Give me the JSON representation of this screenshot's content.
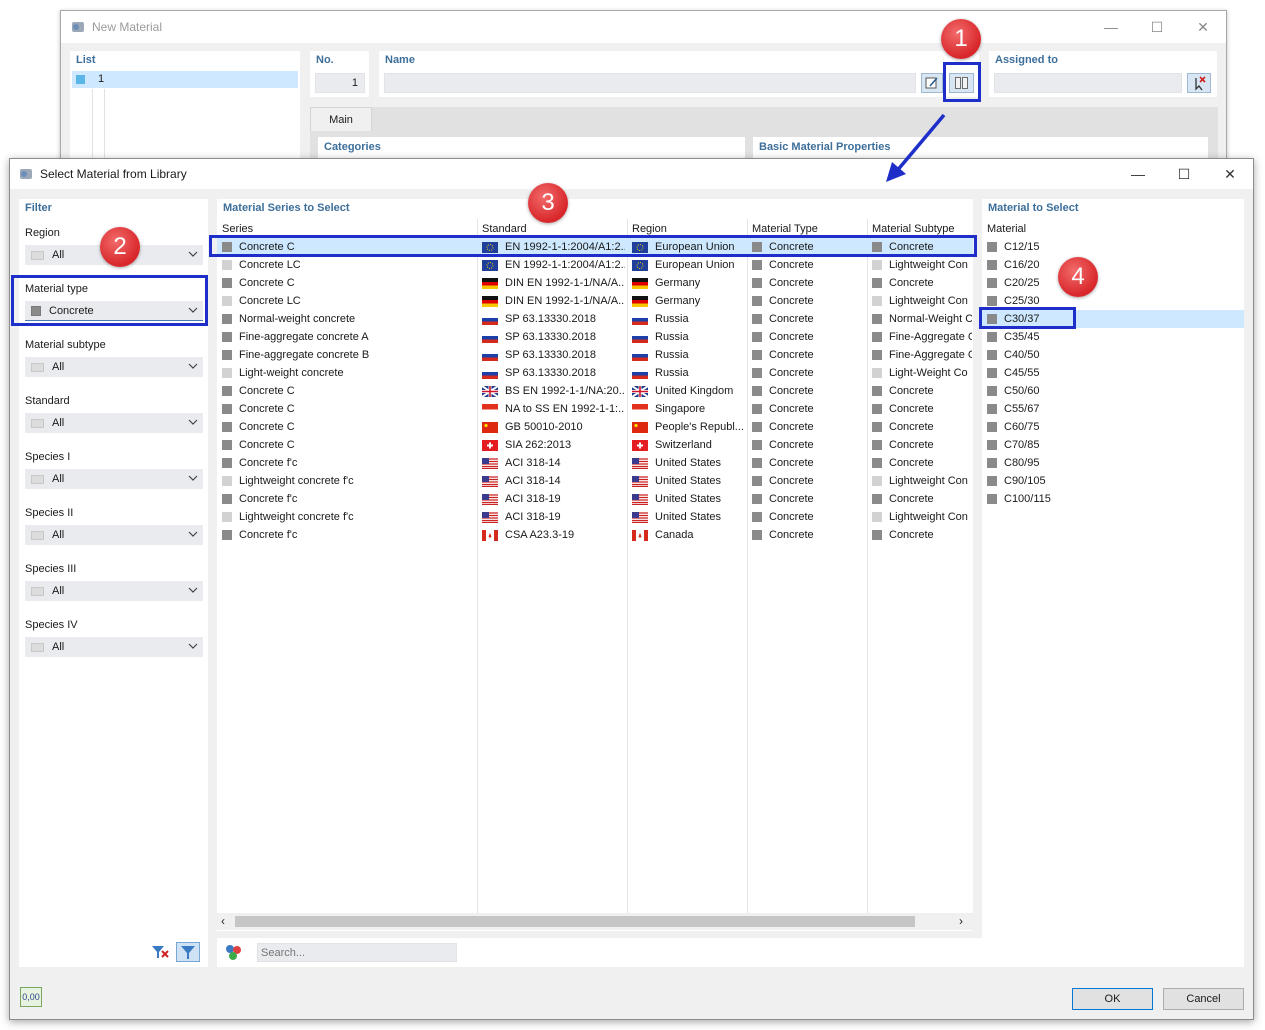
{
  "new_material": {
    "title": "New Material",
    "list_label": "List",
    "list_items": [
      "1"
    ],
    "no_label": "No.",
    "no_value": "1",
    "name_label": "Name",
    "name_value": "",
    "assigned_label": "Assigned to",
    "tab_main": "Main",
    "categories": "Categories",
    "basic_props": "Basic Material Properties"
  },
  "dialog": {
    "title": "Select Material from Library"
  },
  "filter": {
    "title": "Filter",
    "fields": [
      {
        "label": "Region",
        "value": "All"
      },
      {
        "label": "Material type",
        "value": "Concrete"
      },
      {
        "label": "Material subtype",
        "value": "All"
      },
      {
        "label": "Standard",
        "value": "All"
      },
      {
        "label": "Species I",
        "value": "All"
      },
      {
        "label": "Species II",
        "value": "All"
      },
      {
        "label": "Species III",
        "value": "All"
      },
      {
        "label": "Species IV",
        "value": "All"
      }
    ]
  },
  "series": {
    "title": "Material Series to Select",
    "columns": [
      "Series",
      "Standard",
      "Region",
      "Material Type",
      "Material Subtype"
    ],
    "rows": [
      {
        "series": "Concrete C",
        "standard": "EN 1992-1-1:2004/A1:2...",
        "region": "European Union",
        "type": "Concrete",
        "subtype": "Concrete",
        "flag": "eu",
        "light": false
      },
      {
        "series": "Concrete LC",
        "standard": "EN 1992-1-1:2004/A1:2...",
        "region": "European Union",
        "type": "Concrete",
        "subtype": "Lightweight Con",
        "flag": "eu",
        "light": true
      },
      {
        "series": "Concrete C",
        "standard": "DIN EN 1992-1-1/NA/A...",
        "region": "Germany",
        "type": "Concrete",
        "subtype": "Concrete",
        "flag": "de",
        "light": false
      },
      {
        "series": "Concrete LC",
        "standard": "DIN EN 1992-1-1/NA/A...",
        "region": "Germany",
        "type": "Concrete",
        "subtype": "Lightweight Con",
        "flag": "de",
        "light": true
      },
      {
        "series": "Normal-weight concrete",
        "standard": "SP 63.13330.2018",
        "region": "Russia",
        "type": "Concrete",
        "subtype": "Normal-Weight C",
        "flag": "ru",
        "light": false
      },
      {
        "series": "Fine-aggregate concrete A",
        "standard": "SP 63.13330.2018",
        "region": "Russia",
        "type": "Concrete",
        "subtype": "Fine-Aggregate C",
        "flag": "ru",
        "light": false
      },
      {
        "series": "Fine-aggregate concrete B",
        "standard": "SP 63.13330.2018",
        "region": "Russia",
        "type": "Concrete",
        "subtype": "Fine-Aggregate C",
        "flag": "ru",
        "light": false
      },
      {
        "series": "Light-weight concrete",
        "standard": "SP 63.13330.2018",
        "region": "Russia",
        "type": "Concrete",
        "subtype": "Light-Weight Co",
        "flag": "ru",
        "light": true
      },
      {
        "series": "Concrete C",
        "standard": "BS EN 1992-1-1/NA:20...",
        "region": "United Kingdom",
        "type": "Concrete",
        "subtype": "Concrete",
        "flag": "uk",
        "light": false
      },
      {
        "series": "Concrete C",
        "standard": "NA to SS EN 1992-1-1:...",
        "region": "Singapore",
        "type": "Concrete",
        "subtype": "Concrete",
        "flag": "sg",
        "light": false
      },
      {
        "series": "Concrete C",
        "standard": "GB 50010-2010",
        "region": "People's Republ...",
        "type": "Concrete",
        "subtype": "Concrete",
        "flag": "cn",
        "light": false
      },
      {
        "series": "Concrete C",
        "standard": "SIA 262:2013",
        "region": "Switzerland",
        "type": "Concrete",
        "subtype": "Concrete",
        "flag": "ch",
        "light": false
      },
      {
        "series": "Concrete f'c",
        "standard": "ACI 318-14",
        "region": "United States",
        "type": "Concrete",
        "subtype": "Concrete",
        "flag": "us",
        "light": false
      },
      {
        "series": "Lightweight concrete f'c",
        "standard": "ACI 318-14",
        "region": "United States",
        "type": "Concrete",
        "subtype": "Lightweight Con",
        "flag": "us",
        "light": true
      },
      {
        "series": "Concrete f'c",
        "standard": "ACI 318-19",
        "region": "United States",
        "type": "Concrete",
        "subtype": "Concrete",
        "flag": "us",
        "light": false
      },
      {
        "series": "Lightweight concrete f'c",
        "standard": "ACI 318-19",
        "region": "United States",
        "type": "Concrete",
        "subtype": "Lightweight Con",
        "flag": "us",
        "light": true
      },
      {
        "series": "Concrete f'c",
        "standard": "CSA A23.3-19",
        "region": "Canada",
        "type": "Concrete",
        "subtype": "Concrete",
        "flag": "ca",
        "light": false
      }
    ]
  },
  "materials": {
    "title": "Material to Select",
    "column": "Material",
    "items": [
      "C12/15",
      "C16/20",
      "C20/25",
      "C25/30",
      "C30/37",
      "C35/45",
      "C40/50",
      "C45/55",
      "C50/60",
      "C55/67",
      "C60/75",
      "C70/85",
      "C80/95",
      "C90/105",
      "C100/115"
    ],
    "selected": "C30/37"
  },
  "search": {
    "placeholder": "Search..."
  },
  "buttons": {
    "ok": "OK",
    "cancel": "Cancel"
  },
  "status_icon_text": "0,00",
  "callouts": [
    "1",
    "2",
    "3",
    "4"
  ],
  "colors": {
    "selection": "#cde8ff",
    "header_blue": "#3d6f9b",
    "highlight": "#1e2ec8",
    "callout_red": "#d8262a"
  }
}
